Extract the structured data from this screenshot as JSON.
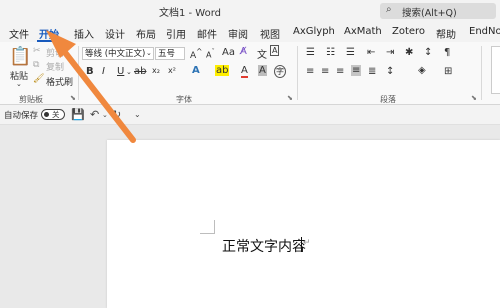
{
  "window": {
    "title": "文档1  -  Word",
    "search_placeholder": "搜索(Alt+Q)"
  },
  "tabs": [
    {
      "label": "文件"
    },
    {
      "label": "开始",
      "active": true
    },
    {
      "label": "插入"
    },
    {
      "label": "设计"
    },
    {
      "label": "布局"
    },
    {
      "label": "引用"
    },
    {
      "label": "邮件"
    },
    {
      "label": "审阅"
    },
    {
      "label": "视图"
    },
    {
      "label": "AxGlyph"
    },
    {
      "label": "AxMath"
    },
    {
      "label": "Zotero"
    },
    {
      "label": "帮助"
    },
    {
      "label": "EndNot"
    }
  ],
  "ribbon": {
    "clipboard": {
      "paste_label": "粘贴",
      "cut_label": "剪切",
      "copy_label": "复制",
      "format_painter_label": "格式刷",
      "group_label": "剪贴板"
    },
    "font": {
      "font_name": "等线 (中文正文)",
      "font_size": "五号",
      "group_label": "字体"
    },
    "paragraph": {
      "group_label": "段落"
    }
  },
  "qat": {
    "autosave_label": "自动保存",
    "autosave_state": "关"
  },
  "document": {
    "body_text": "正常文字内容",
    "paragraph_mark": "↵"
  },
  "colors": {
    "accent": "#185abd",
    "arrow": "#f0883e"
  }
}
